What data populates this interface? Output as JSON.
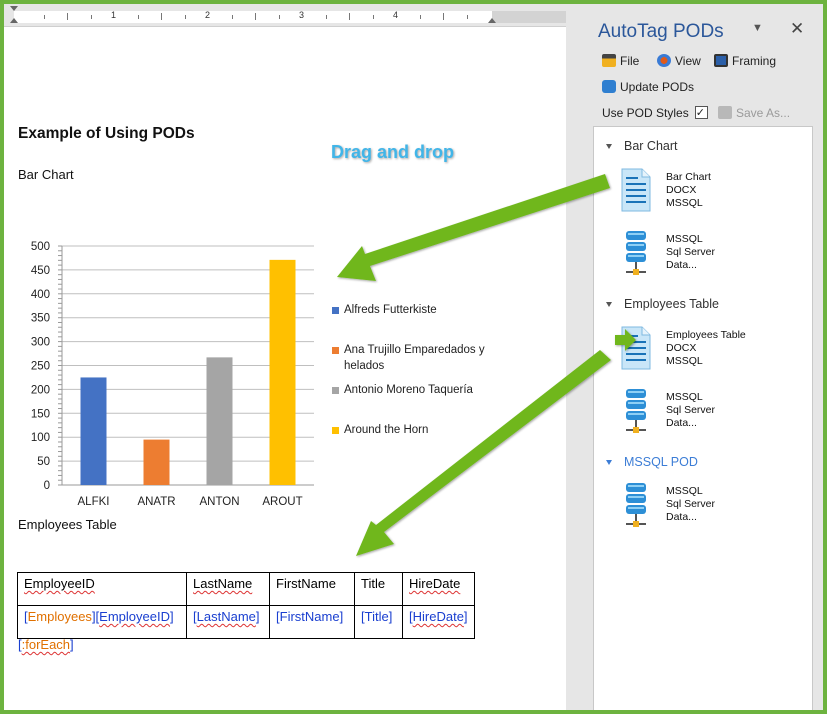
{
  "document": {
    "title": "Example of Using PODs",
    "bar_chart_heading": "Bar Chart",
    "employees_heading": "Employees Table",
    "callout": "Drag and drop",
    "ruler_numbers": [
      "1",
      "2",
      "3",
      "4"
    ]
  },
  "chart_data": {
    "type": "bar",
    "categories": [
      "ALFKI",
      "ANATR",
      "ANTON",
      "AROUT"
    ],
    "series": [
      {
        "name": "Alfreds Futterkiste",
        "values": [
          225
        ],
        "color": "#4472c4"
      },
      {
        "name": "Ana Trujillo Emparedados y helados",
        "values": [
          95
        ],
        "color": "#ed7d31"
      },
      {
        "name": "Antonio Moreno Taquería",
        "values": [
          267
        ],
        "color": "#a5a5a5"
      },
      {
        "name": "Around the Horn",
        "values": [
          471
        ],
        "color": "#ffc000"
      }
    ],
    "values": [
      225,
      95,
      267,
      471
    ],
    "ylim": [
      0,
      500
    ],
    "yticks": [
      "500",
      "450",
      "400",
      "350",
      "300",
      "250",
      "200",
      "150",
      "100",
      "50",
      "0"
    ],
    "grid": true,
    "legend_position": "right"
  },
  "table": {
    "headers": [
      "EmployeeID",
      "LastName",
      "FirstName",
      "Title",
      "HireDate"
    ],
    "row": {
      "c0_open": "[",
      "c0_tag1": "Employees",
      "c0_mid": "][",
      "c0_tag2": "EmployeeID",
      "c0_close": "]",
      "c1": "LastName",
      "c2": "FirstName",
      "c3": "Title",
      "c4": "HireDate"
    },
    "foreach_open": "[",
    "foreach_tag": ":forEach",
    "foreach_close": "]"
  },
  "panel": {
    "title": "AutoTag PODs",
    "dropdown_glyph": "▼",
    "close_glyph": "✕",
    "toolbar": {
      "file": "File",
      "view": "View",
      "framing": "Framing",
      "update": "Update PODs",
      "use_pod_styles": "Use POD Styles",
      "save_as": "Save As..."
    },
    "groups": [
      {
        "name": "Bar Chart",
        "items": [
          {
            "icon": "document-icon",
            "lines": [
              "Bar Chart",
              "DOCX",
              "MSSQL"
            ]
          },
          {
            "icon": "database-icon",
            "lines": [
              "MSSQL",
              "Sql Server",
              "Data..."
            ]
          }
        ]
      },
      {
        "name": "Employees Table",
        "items": [
          {
            "icon": "document-icon",
            "lines": [
              "Employees Table",
              "DOCX",
              "MSSQL"
            ]
          },
          {
            "icon": "database-icon",
            "lines": [
              "MSSQL",
              "Sql Server",
              "Data..."
            ]
          }
        ]
      },
      {
        "name": "MSSQL POD",
        "items": [
          {
            "icon": "database-icon",
            "lines": [
              "MSSQL",
              "Sql Server",
              "Data..."
            ]
          }
        ]
      }
    ]
  },
  "colors": {
    "frame": "#6db33f",
    "arrow": "#6fb71f",
    "callout": "#41b5e8",
    "panel_title": "#2b579a",
    "tag_orange": "#e07000",
    "tag_blue": "#1a3fd0"
  }
}
